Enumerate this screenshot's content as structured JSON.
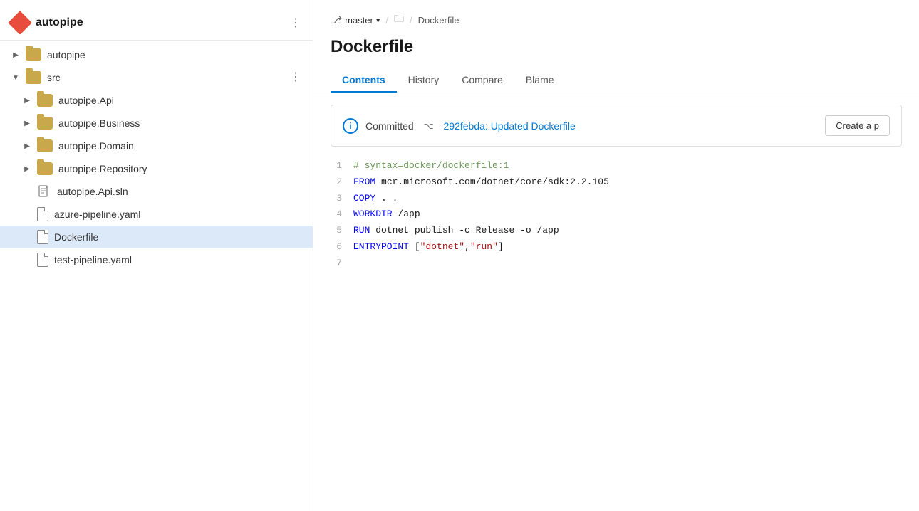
{
  "sidebar": {
    "logo": "autopipe",
    "items": [
      {
        "id": "autopipe-root",
        "label": "autopipe",
        "type": "folder",
        "indent": 0,
        "expanded": false,
        "hasChevron": true
      },
      {
        "id": "src",
        "label": "src",
        "type": "folder",
        "indent": 0,
        "expanded": true,
        "hasChevron": true,
        "hasMore": true
      },
      {
        "id": "autopipe-api",
        "label": "autopipe.Api",
        "type": "folder",
        "indent": 1,
        "expanded": false,
        "hasChevron": true
      },
      {
        "id": "autopipe-business",
        "label": "autopipe.Business",
        "type": "folder",
        "indent": 1,
        "expanded": false,
        "hasChevron": true
      },
      {
        "id": "autopipe-domain",
        "label": "autopipe.Domain",
        "type": "folder",
        "indent": 1,
        "expanded": false,
        "hasChevron": true
      },
      {
        "id": "autopipe-repository",
        "label": "autopipe.Repository",
        "type": "folder",
        "indent": 1,
        "expanded": false,
        "hasChevron": true
      },
      {
        "id": "autopipe-api-sln",
        "label": "autopipe.Api.sln",
        "type": "sln",
        "indent": 1,
        "hasChevron": false
      },
      {
        "id": "azure-pipeline",
        "label": "azure-pipeline.yaml",
        "type": "file",
        "indent": 1,
        "hasChevron": false
      },
      {
        "id": "dockerfile",
        "label": "Dockerfile",
        "type": "file",
        "indent": 1,
        "hasChevron": false,
        "selected": true
      },
      {
        "id": "test-pipeline",
        "label": "test-pipeline.yaml",
        "type": "file",
        "indent": 1,
        "hasChevron": false
      }
    ]
  },
  "breadcrumb": {
    "branch": "master",
    "folder_icon": "📁",
    "separator": "/",
    "file": "Dockerfile"
  },
  "file": {
    "title": "Dockerfile"
  },
  "tabs": [
    {
      "id": "contents",
      "label": "Contents",
      "active": true
    },
    {
      "id": "history",
      "label": "History",
      "active": false
    },
    {
      "id": "compare",
      "label": "Compare",
      "active": false
    },
    {
      "id": "blame",
      "label": "Blame",
      "active": false
    }
  ],
  "commit": {
    "label": "Committed",
    "hash": "292febda: Updated Dockerfile",
    "create_btn": "Create a p"
  },
  "code": {
    "lines": [
      {
        "num": 1,
        "content": "# syntax=docker/dockerfile:1",
        "type": "comment"
      },
      {
        "num": 2,
        "content": "FROM mcr.microsoft.com/dotnet/core/sdk:2.2.105",
        "type": "from"
      },
      {
        "num": 3,
        "content": "COPY . .",
        "type": "copy"
      },
      {
        "num": 4,
        "content": "WORKDIR /app",
        "type": "workdir"
      },
      {
        "num": 5,
        "content": "RUN dotnet publish -c Release -o /app",
        "type": "run"
      },
      {
        "num": 6,
        "content": "ENTRYPOINT [\"dotnet\",\"run\"]",
        "type": "entrypoint"
      },
      {
        "num": 7,
        "content": "",
        "type": "empty"
      }
    ]
  }
}
